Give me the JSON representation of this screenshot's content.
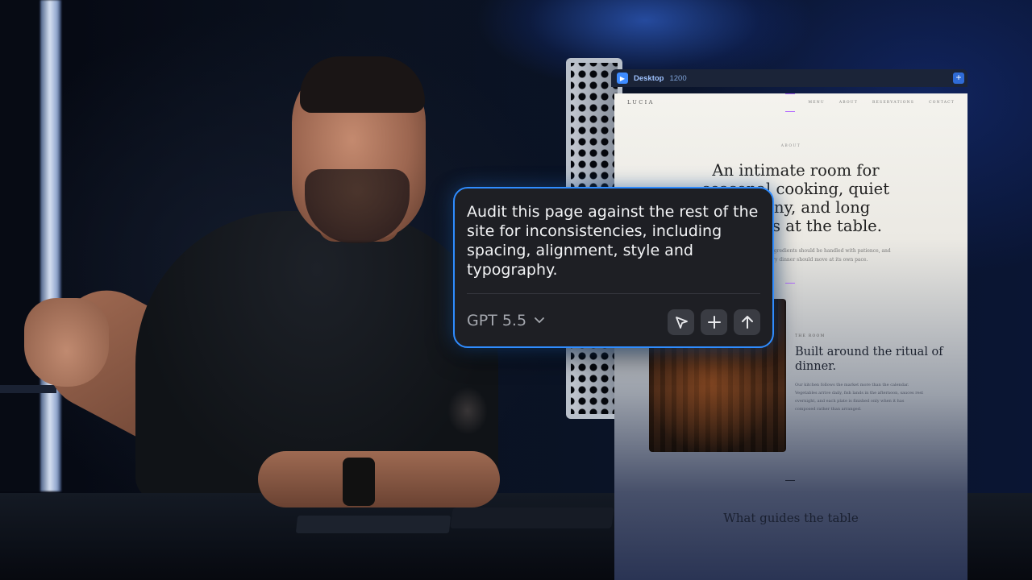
{
  "preview": {
    "device_label": "Desktop",
    "device_width": "1200",
    "add_label": "+"
  },
  "site": {
    "logo": "LUCIA",
    "nav": [
      "MENU",
      "ABOUT",
      "RESERVATIONS",
      "CONTACT"
    ],
    "eyebrow": "ABOUT",
    "hero_heading": "An intimate room for seasonal cooking, quiet company, and long evenings at the table.",
    "hero_body": "We believe ingredients should be handled with patience, and every dinner should move at its own pace.",
    "room_eyebrow": "THE ROOM",
    "room_heading": "Built around the ritual of dinner.",
    "room_body": "Our kitchen follows the market more than the calendar. Vegetables arrive daily, fish lands in the afternoon, sauces rest overnight, and each plate is finished only when it has composed rather than arranged.",
    "guides_heading": "What guides the table"
  },
  "prompt": {
    "text": "Audit this page against the rest of the site for inconsistencies, including spacing, alignment, style and typography.",
    "model": "GPT 5.5",
    "model_chevron_icon": "chevron-down-icon",
    "actions": [
      "cursor-select-icon",
      "plus-icon",
      "send-arrow-up-icon"
    ]
  },
  "colors": {
    "accent": "#2f8cff",
    "popover_bg": "#1e1f24",
    "guide": "#b36bff"
  }
}
